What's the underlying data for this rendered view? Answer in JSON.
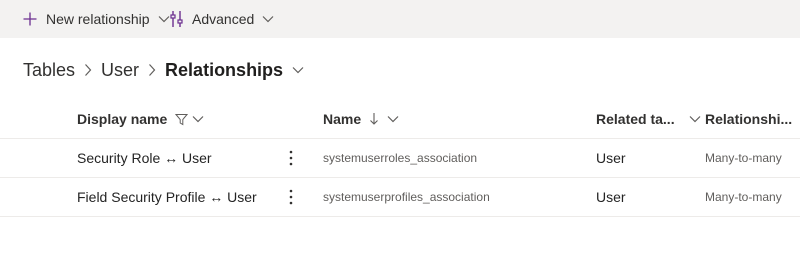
{
  "toolbar": {
    "new_relationship_label": "New relationship",
    "advanced_label": "Advanced"
  },
  "breadcrumb": {
    "items": [
      "Tables",
      "User"
    ],
    "current": "Relationships"
  },
  "grid": {
    "columns": {
      "display_name": "Display name",
      "name": "Name",
      "related_table": "Related ta...",
      "relationship_type": "Relationshi..."
    },
    "rows": [
      {
        "display_name": "Security Role ↔ User",
        "name": "systemuserroles_association",
        "related_table": "User",
        "relationship_type": "Many-to-many"
      },
      {
        "display_name": "Field Security Profile ↔ User",
        "name": "systemuserprofiles_association",
        "related_table": "User",
        "relationship_type": "Many-to-many"
      }
    ]
  },
  "colors": {
    "accent": "#6b2e8f",
    "toolbar_bg": "#f3f2f1",
    "divider": "#edebe9"
  }
}
